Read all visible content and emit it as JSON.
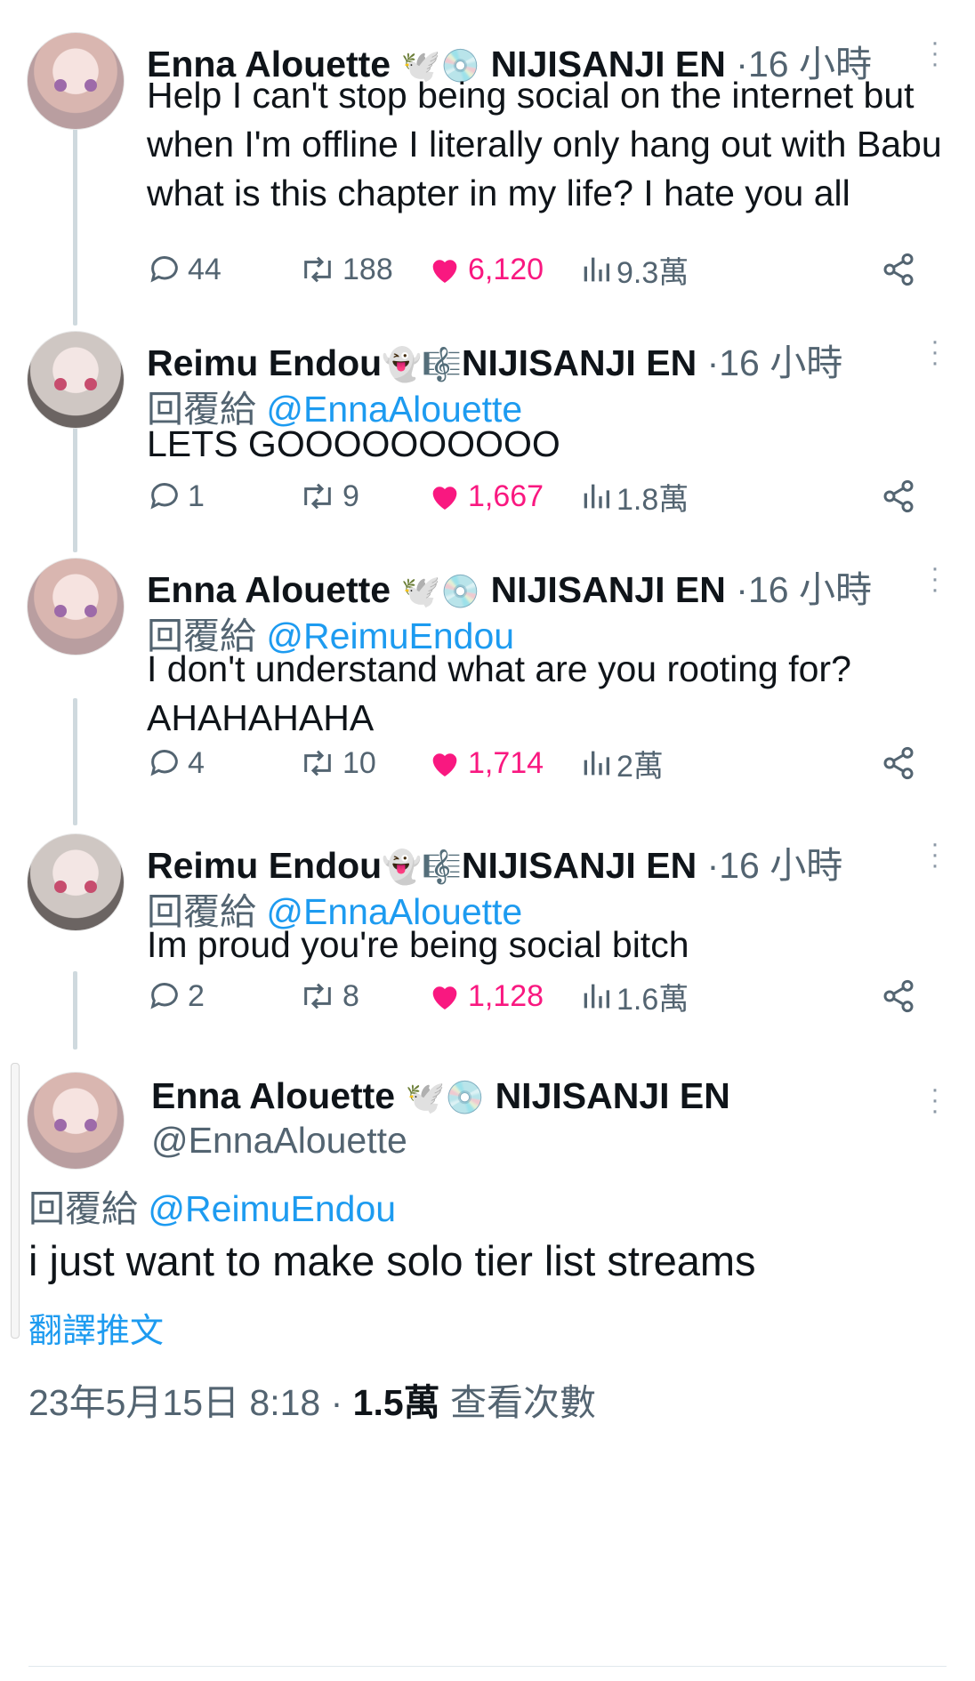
{
  "tweets": [
    {
      "name": "Enna Alouette",
      "emojis": "🕊️💿",
      "affiliation": "NIJISANJI EN",
      "time": "16 小時",
      "reply_label": "",
      "reply_handle": "",
      "text": "Help I can't stop being social on the internet but when I'm offline I literally only hang out with Babu what is this chapter in my life? I hate you all",
      "replies": "44",
      "retweets": "188",
      "likes": "6,120",
      "views": "9.3萬"
    },
    {
      "name": "Reimu Endou",
      "emojis": "👻🎼",
      "affiliation": "NIJISANJI EN",
      "time": "16 小時",
      "reply_label": "回覆給",
      "reply_handle": "@EnnaAlouette",
      "text": "LETS GOOOOOOOOOO",
      "replies": "1",
      "retweets": "9",
      "likes": "1,667",
      "views": "1.8萬"
    },
    {
      "name": "Enna Alouette",
      "emojis": "🕊️💿",
      "affiliation": "NIJISANJI EN",
      "time": "16 小時",
      "reply_label": "回覆給",
      "reply_handle": "@ReimuEndou",
      "text": "I don't understand what are you rooting for? AHAHAHAHA",
      "replies": "4",
      "retweets": "10",
      "likes": "1,714",
      "views": "2萬"
    },
    {
      "name": "Reimu Endou",
      "emojis": "👻🎼",
      "affiliation": "NIJISANJI EN",
      "time": "16 小時",
      "reply_label": "回覆給",
      "reply_handle": "@EnnaAlouette",
      "text": "Im proud you're being social bitch",
      "replies": "2",
      "retweets": "8",
      "likes": "1,128",
      "views": "1.6萬"
    }
  ],
  "focus": {
    "name": "Enna Alouette",
    "emojis": "🕊️💿",
    "affiliation": "NIJISANJI EN",
    "handle": "@EnnaAlouette",
    "reply_label": "回覆給",
    "reply_handle": "@ReimuEndou",
    "text": "i just want to make solo tier list streams",
    "translate": "翻譯推文",
    "date": "23年5月15日 8:18",
    "views": "1.5萬",
    "views_label": "查看次數"
  },
  "icons": {
    "reply": "reply-icon",
    "retweet": "retweet-icon",
    "like": "heart-icon",
    "views": "views-icon",
    "share": "share-icon",
    "more": "more-icon"
  },
  "colors": {
    "accent": "#1d9bf0",
    "like": "#f91880",
    "muted": "#536471"
  }
}
